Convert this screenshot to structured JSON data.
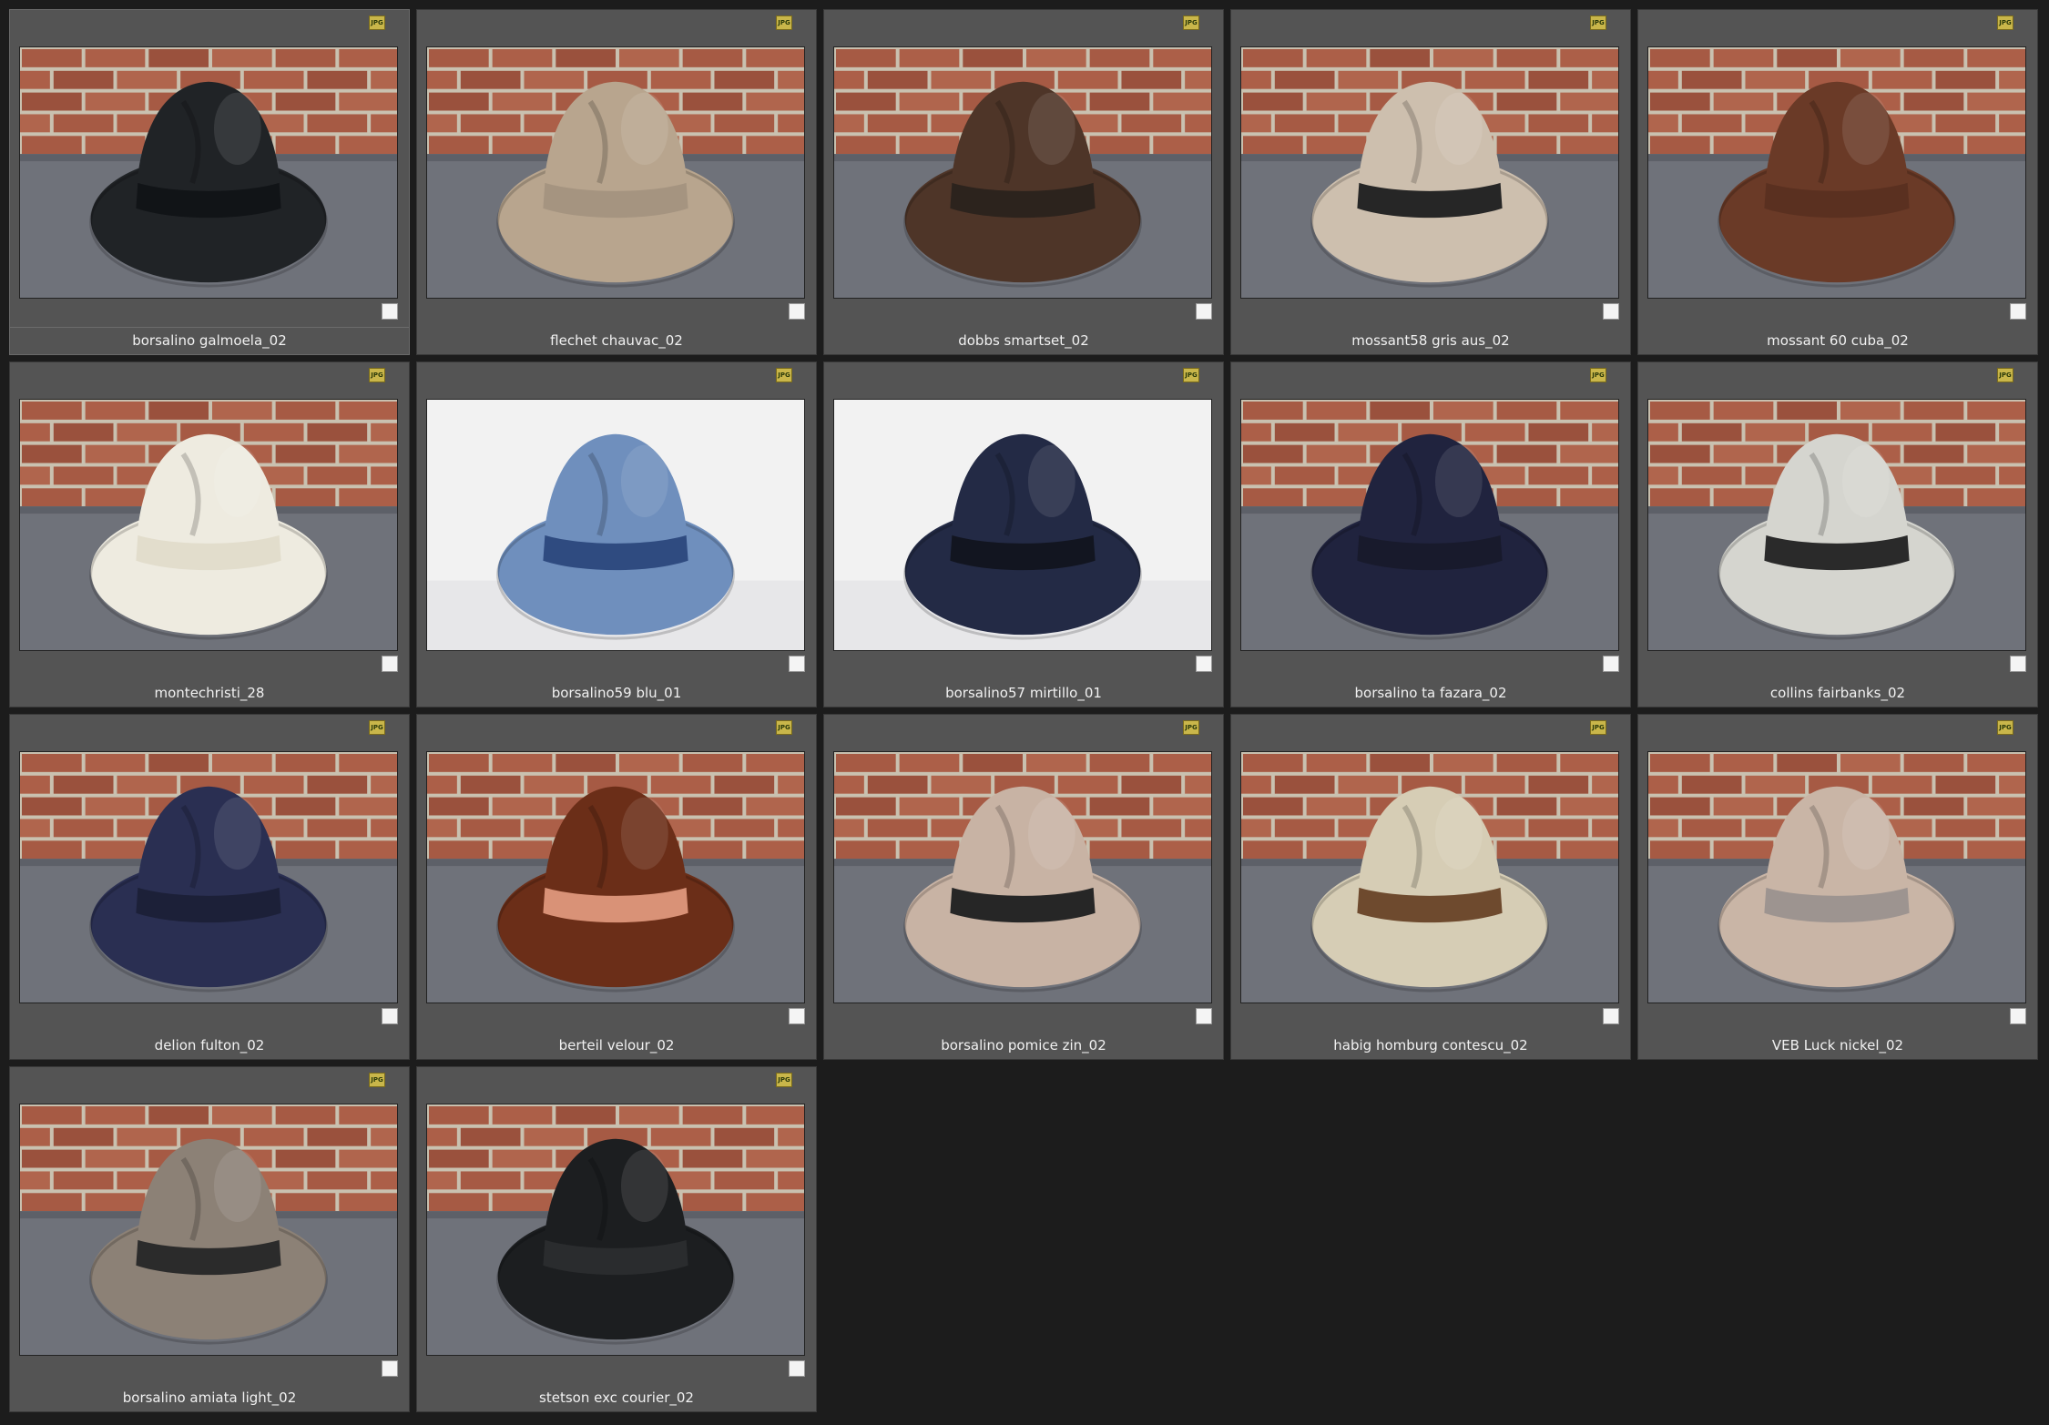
{
  "badge_label": "JPG",
  "colors": {
    "background": "#1c1c1c",
    "tile": "#545454",
    "brick_wall": "#a65a44",
    "mortar": "#c9c1b0",
    "white_backdrop": "#f2f2f2"
  },
  "items": [
    {
      "name": "borsalino galmoela_02",
      "bg": "brick",
      "hat": "#202326",
      "band": "#111417",
      "selected": true
    },
    {
      "name": "flechet chauvac_02",
      "bg": "brick",
      "hat": "#b8a58e",
      "band": "#a59480"
    },
    {
      "name": "dobbs smartset_02",
      "bg": "brick",
      "hat": "#4e3528",
      "band": "#2c231d"
    },
    {
      "name": "mossant58 gris aus_02",
      "bg": "brick",
      "hat": "#cdbfae",
      "band": "#262626"
    },
    {
      "name": "mossant 60 cuba_02",
      "bg": "brick",
      "hat": "#6a3a27",
      "band": "#5a3020"
    },
    {
      "name": "montechristi_28",
      "bg": "brick",
      "hat": "#eeebe0",
      "band": "#e2ddcc"
    },
    {
      "name": "borsalino59 blu_01",
      "bg": "white",
      "hat": "#6f8fbd",
      "band": "#2f4b80"
    },
    {
      "name": "borsalino57 mirtillo_01",
      "bg": "white",
      "hat": "#232a45",
      "band": "#121520"
    },
    {
      "name": "borsalino ta fazara_02",
      "bg": "brick",
      "hat": "#20233e",
      "band": "#181a2c"
    },
    {
      "name": "collins fairbanks_02",
      "bg": "brick",
      "hat": "#d5d5cf",
      "band": "#2a2a2a"
    },
    {
      "name": "delion fulton_02",
      "bg": "brick",
      "hat": "#2a2f52",
      "band": "#1c2038"
    },
    {
      "name": "berteil velour_02",
      "bg": "brick",
      "hat": "#6b2e18",
      "band": "#d99277"
    },
    {
      "name": "borsalino pomice zin_02",
      "bg": "brick",
      "hat": "#c8b3a4",
      "band": "#262626"
    },
    {
      "name": "habig homburg contescu_02",
      "bg": "brick",
      "hat": "#d6cdb5",
      "band": "#6e4a2e"
    },
    {
      "name": "VEB Luck nickel_02",
      "bg": "brick",
      "hat": "#c9b5a6",
      "band": "#9d9490"
    },
    {
      "name": "borsalino amiata light_02",
      "bg": "brick",
      "hat": "#8c8176",
      "band": "#2b2b2b"
    },
    {
      "name": "stetson exc courier_02",
      "bg": "brick",
      "hat": "#1c1e20",
      "band": "#2a2c2e"
    }
  ]
}
